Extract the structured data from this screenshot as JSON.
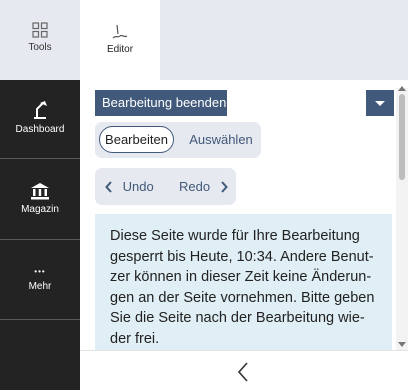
{
  "rail": {
    "tools_label": "Tools",
    "editor_label": "Editor",
    "items": [
      {
        "label": "Dashboard",
        "icon": "desk-lamp-icon"
      },
      {
        "label": "Magazin",
        "icon": "building-icon"
      },
      {
        "label": "Mehr",
        "icon": "more-dots-icon",
        "glyph": "•••"
      }
    ]
  },
  "toolbar": {
    "end_editing_label": "Bearbeitung beenden",
    "dropdown_icon": "caret-down-icon"
  },
  "mode_switch": {
    "edit_label": "Bearbeiten",
    "select_label": "Auswählen",
    "active": "Bearbeiten"
  },
  "history": {
    "undo_label": "Undo",
    "redo_label": "Redo"
  },
  "notice": {
    "text": "Diese Seite wurde für Ihre Bearbeitung gesperrt bis Heute, 10:34. Andere Benut-zer können in dieser Zeit keine Änderun-gen an der Seite vornehmen. Bitte geben Sie die Seite nach der Bearbeitung wie-der frei."
  },
  "colors": {
    "rail_bg": "#232323",
    "top_bg": "#e6e9ef",
    "accent": "#41597a",
    "notice_bg": "#e0eef5"
  }
}
